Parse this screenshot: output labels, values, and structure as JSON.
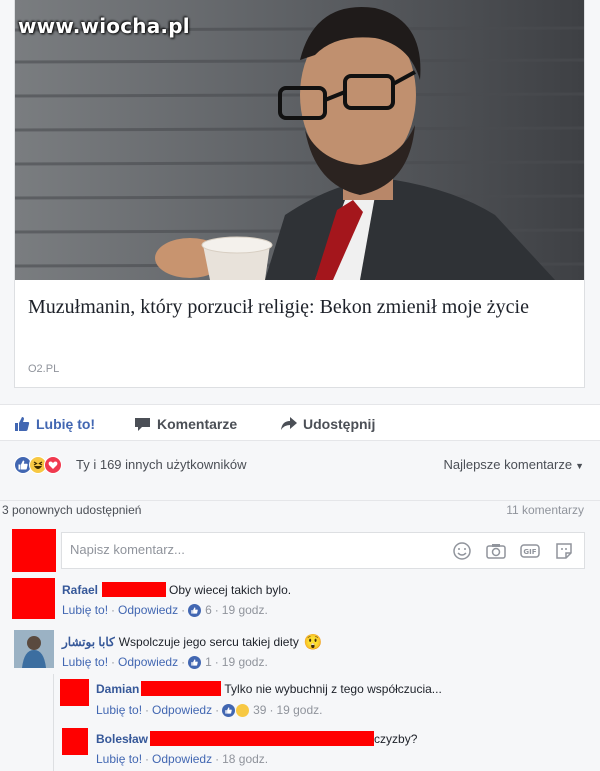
{
  "watermark": "www.wiocha.pl",
  "post": {
    "headline": "Muzułmanin, który porzucił religię: Bekon zmienił moje życie",
    "source": "O2.PL"
  },
  "actions": {
    "like": "Lubię to!",
    "comment": "Komentarze",
    "share": "Udostępnij"
  },
  "reactions": {
    "icons": [
      "like-reaction",
      "haha-reaction",
      "love-reaction"
    ],
    "summary": "Ty i 169 innych użytkowników",
    "sort_label": "Najlepsze komentarze"
  },
  "shares": "3 ponownych udostępnień",
  "comment_count": "11 komentarzy",
  "composer": {
    "placeholder": "Napisz komentarz..."
  },
  "comments": [
    {
      "author": "Rafael",
      "text": "Oby wiecej takich bylo.",
      "like_label": "Lubię to!",
      "reply_label": "Odpowiedz",
      "likes": "6",
      "time": "19 godz."
    },
    {
      "author": "کابا بوتشار",
      "text": "Wspolczuje jego sercu takiej diety",
      "emoji": "😲",
      "like_label": "Lubię to!",
      "reply_label": "Odpowiedz",
      "likes": "1",
      "time": "19 godz."
    },
    {
      "author": "Damian",
      "text": "Tylko nie wybuchnij z tego współczucia...",
      "like_label": "Lubię to!",
      "reply_label": "Odpowiedz",
      "likes": "39",
      "time": "19 godz."
    },
    {
      "author": "Bolesław",
      "text": "czyzby?",
      "like_label": "Lubię to!",
      "reply_label": "Odpowiedz",
      "time": "18 godz."
    }
  ],
  "colors": {
    "fb_blue": "#4267b2",
    "link": "#365899",
    "redaction": "#ff0000"
  }
}
